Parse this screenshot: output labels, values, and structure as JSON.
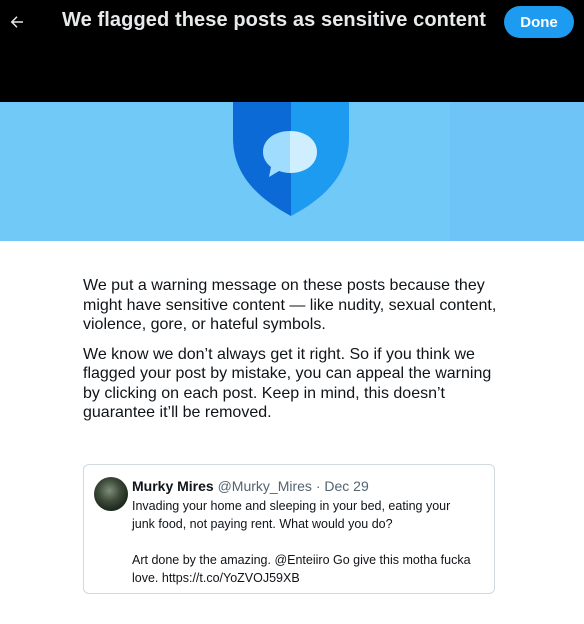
{
  "header": {
    "title": "We flagged these posts as sensitive content",
    "done_label": "Done"
  },
  "icons": {
    "back": "arrow-left-icon",
    "banner": "shield-chat-bubble-icon"
  },
  "colors": {
    "header_bg": "#000000",
    "banner_bg": "#71c9f8",
    "accent": "#1d9bf0",
    "shield_dark": "#0b6ad6",
    "shield_light": "#1d9bf0"
  },
  "body": {
    "paragraph_1": "We put a warning message on these posts because they might have sensitive content — like nudity, sexual content, violence, gore, or hateful symbols.",
    "paragraph_2": "We know we don’t always get it right. So if you think we flagged your post by mistake, you can appeal the warning by clicking on each post. Keep in mind, this doesn’t guarantee it’ll be removed."
  },
  "tweet": {
    "name": "Murky Mires",
    "handle": "@Murky_Mires",
    "separator": "·",
    "date": "Dec 29",
    "text_line_1": "Invading your home and sleeping in your bed, eating your",
    "text_line_2": "junk food, not paying rent. What would you do?",
    "text_line_3": "Art done by the amazing. @Enteiiro Go give this motha fucka",
    "text_line_4": "love. https://t.co/YoZVOJ59XB"
  }
}
